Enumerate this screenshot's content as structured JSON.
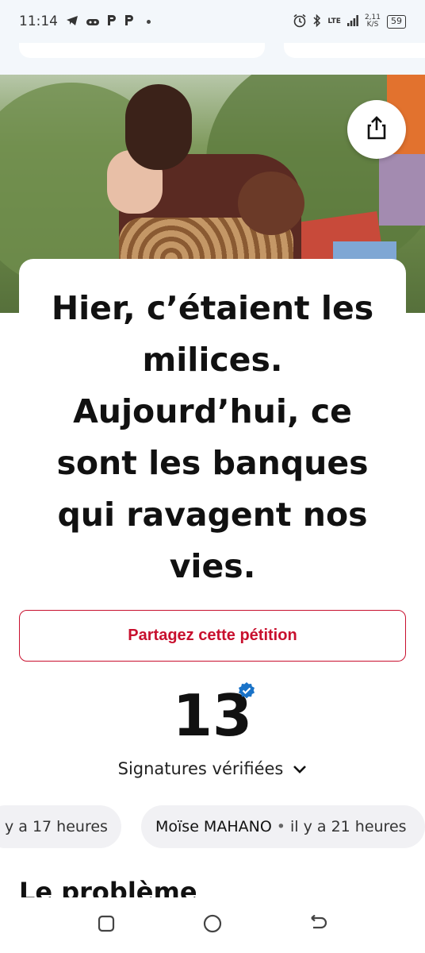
{
  "status_bar": {
    "time": "11:14",
    "net_type": "LTE",
    "speed_value": "2,11",
    "speed_unit": "K/S",
    "battery": "59"
  },
  "hero_image": {
    "icon": "photo"
  },
  "share_icon_button": {
    "icon": "share-icon"
  },
  "petition": {
    "title": "Hier, c’étaient les milices. Aujourd’hui, ce sont les banques qui ravagent nos vies.",
    "share_button_label": "Partagez cette pétition",
    "signature_count": "13",
    "signatures_label": "Signatures vérifiées",
    "section_heading": "Le problème"
  },
  "recent_signers": [
    {
      "name": "",
      "time": "y a 17 heures"
    },
    {
      "name": "Moïse MAHANO",
      "time": "il y a 21 heures"
    }
  ],
  "colors": {
    "accent": "#c8102e",
    "verified": "#1a73c8"
  }
}
